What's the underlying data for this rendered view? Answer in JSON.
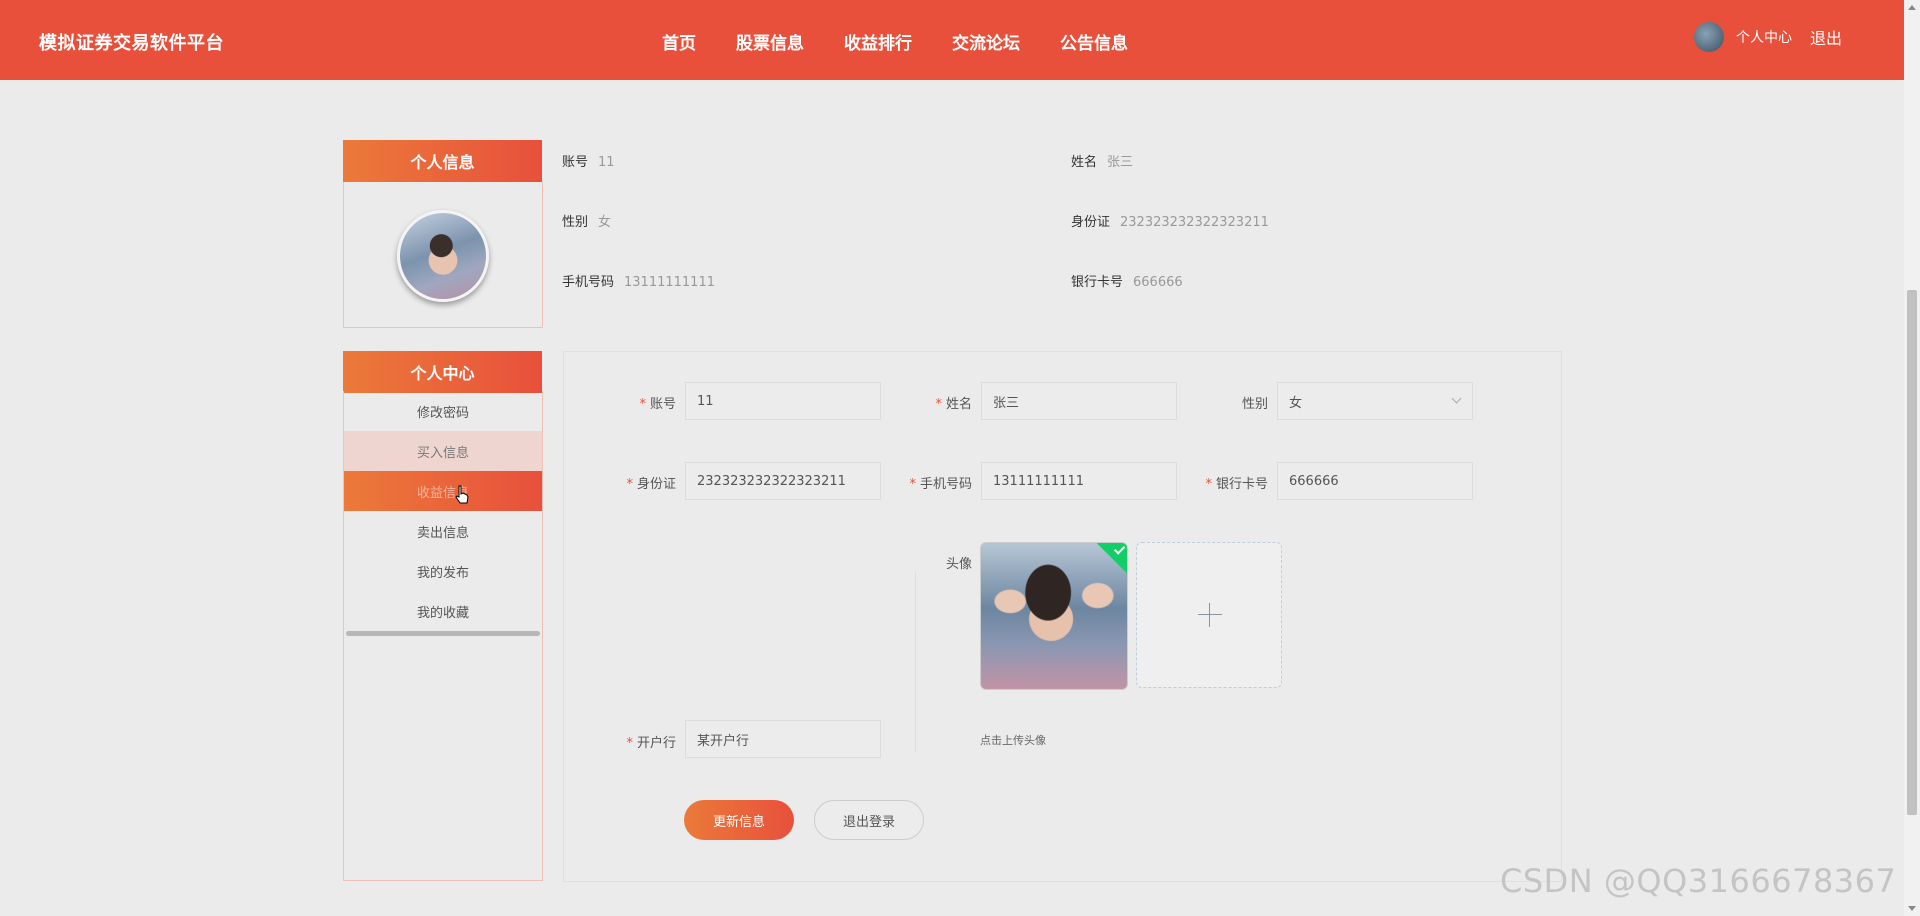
{
  "header": {
    "brand": "模拟证券交易软件平台",
    "nav": [
      "首页",
      "股票信息",
      "收益排行",
      "交流论坛",
      "公告信息"
    ],
    "user_center": "个人中心",
    "logout": "退出"
  },
  "sidebar": {
    "profile_title": "个人信息",
    "center_title": "个人中心",
    "menu": [
      "修改密码",
      "买入信息",
      "收益信息",
      "卖出信息",
      "我的发布",
      "我的收藏"
    ]
  },
  "info": {
    "account": {
      "label": "账号",
      "value": "11"
    },
    "name": {
      "label": "姓名",
      "value": "张三"
    },
    "gender": {
      "label": "性别",
      "value": "女"
    },
    "id_card": {
      "label": "身份证",
      "value": "232323232322323211"
    },
    "phone": {
      "label": "手机号码",
      "value": "13111111111"
    },
    "bank_card": {
      "label": "银行卡号",
      "value": "666666"
    }
  },
  "form": {
    "account": {
      "label": "账号",
      "value": "11"
    },
    "name": {
      "label": "姓名",
      "value": "张三"
    },
    "gender": {
      "label": "性别",
      "value": "女"
    },
    "id_card": {
      "label": "身份证",
      "value": "232323232322323211"
    },
    "phone": {
      "label": "手机号码",
      "value": "13111111111"
    },
    "bank_card": {
      "label": "银行卡号",
      "value": "666666"
    },
    "avatar": {
      "label": "头像",
      "tip": "点击上传头像"
    },
    "bank": {
      "label": "开户行",
      "value": "某开户行"
    },
    "submit": "更新信息",
    "logout": "退出登录"
  },
  "watermark": "CSDN @QQ3166678367",
  "colors": {
    "brand": "#e8503b",
    "accent": "#eb7a3a",
    "success": "#13ce66"
  }
}
